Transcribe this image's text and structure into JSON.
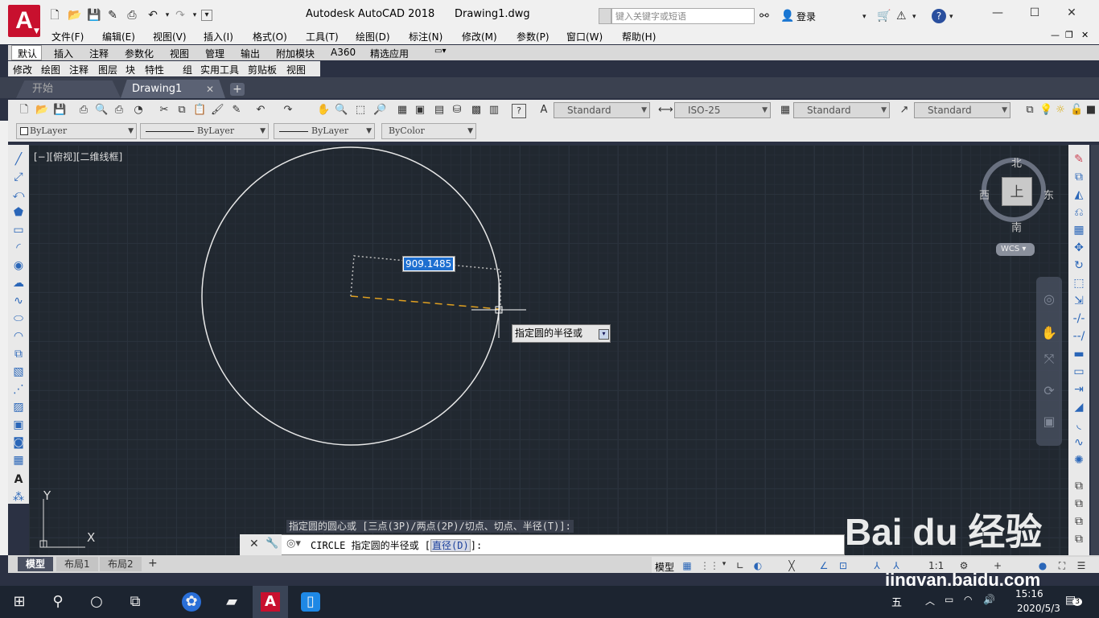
{
  "window": {
    "title": "Autodesk AutoCAD 2018",
    "filename": "Drawing1.dwg",
    "search_placeholder": "键入关键字或短语",
    "login_label": "登录",
    "logo_letter": "A"
  },
  "menu": [
    "文件(F)",
    "编辑(E)",
    "视图(V)",
    "插入(I)",
    "格式(O)",
    "工具(T)",
    "绘图(D)",
    "标注(N)",
    "修改(M)",
    "参数(P)",
    "窗口(W)",
    "帮助(H)"
  ],
  "ribbon_tabs": [
    "默认",
    "插入",
    "注释",
    "参数化",
    "视图",
    "管理",
    "输出",
    "附加模块",
    "A360",
    "精选应用"
  ],
  "ribbon_panels": [
    "修改",
    "绘图",
    "注释",
    "图层",
    "块",
    "特性",
    "组",
    "实用工具",
    "剪贴板",
    "视图"
  ],
  "doc_tabs": {
    "start": "开始",
    "drawing": "Drawing1",
    "add": "+"
  },
  "styles": {
    "text_style": "Standard",
    "dim_style": "ISO-25",
    "table_style": "Standard",
    "mleader_style": "Standard"
  },
  "properties": {
    "layer": "ByLayer",
    "linetype": "ByLayer",
    "lineweight": "ByLayer",
    "color": "ByColor"
  },
  "viewport": {
    "label": "[−][俯视][二维线框]",
    "compass": {
      "north": "北",
      "south": "南",
      "west": "西",
      "east": "东",
      "top": "上"
    },
    "wcs": "WCS",
    "ucs_x": "X",
    "ucs_y": "Y"
  },
  "dynamic_input": {
    "value": "909.1485",
    "prompt": "指定圆的半径或"
  },
  "command": {
    "history": "指定圆的圆心或 [三点(3P)/两点(2P)/切点、切点、半径(T)]:",
    "current_prefix": "CIRCLE 指定圆的半径或 [",
    "option": "直径(D)",
    "current_suffix": "]:"
  },
  "layout_tabs": [
    "模型",
    "布局1",
    "布局2"
  ],
  "status": {
    "model": "模型",
    "scale": "1:1"
  },
  "taskbar": {
    "time": "15:16",
    "date": "2020/5/3",
    "ime": "五",
    "notifications": "3"
  },
  "watermark": {
    "brand": "Bai du 经验",
    "url": "jingyan.baidu.com"
  },
  "colors": {
    "accent": "#c8102e",
    "canvas": "#212830",
    "selection": "#1e6fd0",
    "rubberband": "#e0a020"
  }
}
